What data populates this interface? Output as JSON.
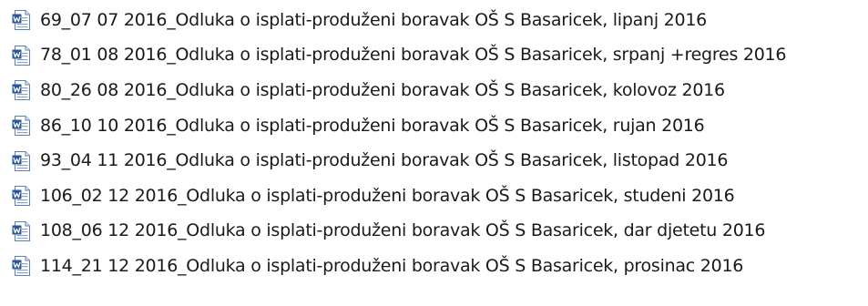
{
  "file_list": {
    "icon": "word-document-icon",
    "items": [
      {
        "name": "69_07 07 2016_Odluka o isplati-produženi boravak OŠ S Basaricek, lipanj 2016"
      },
      {
        "name": "78_01 08 2016_Odluka o isplati-produženi boravak OŠ S Basaricek, srpanj +regres 2016"
      },
      {
        "name": "80_26 08 2016_Odluka o isplati-produženi boravak OŠ S Basaricek, kolovoz 2016"
      },
      {
        "name": "86_10 10 2016_Odluka o isplati-produženi boravak OŠ S Basaricek, rujan 2016"
      },
      {
        "name": "93_04 11 2016_Odluka o isplati-produženi boravak OŠ S Basaricek, listopad 2016"
      },
      {
        "name": "106_02 12 2016_Odluka o isplati-produženi boravak OŠ S Basaricek, studeni 2016"
      },
      {
        "name": "108_06 12 2016_Odluka o isplati-produženi boravak OŠ S Basaricek, dar djetetu 2016"
      },
      {
        "name": "114_21 12 2016_Odluka o isplati-produženi boravak OŠ S Basaricek, prosinac 2016"
      }
    ]
  },
  "colors": {
    "icon_blue": "#2b579a",
    "text": "#1a1a1a"
  }
}
